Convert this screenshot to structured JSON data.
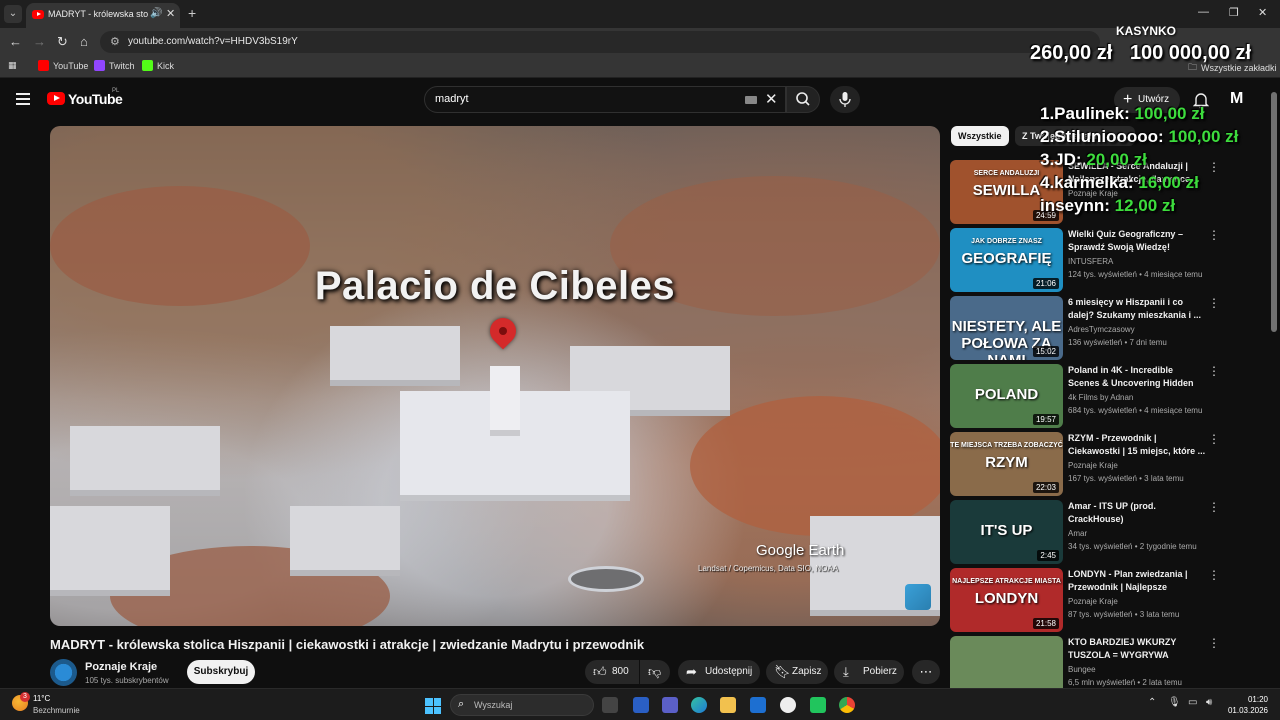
{
  "browser": {
    "tab_title": "MADRYT - królewska stolica Hiszpanii",
    "url": "youtube.com/watch?v=HHDV3bS19rY",
    "bookmarks": [
      {
        "label": "YouTube",
        "color": "#ff0000"
      },
      {
        "label": "Twitch",
        "color": "#9146ff"
      },
      {
        "label": "Kick",
        "color": "#53fc18"
      }
    ],
    "all_bookmarks_label": "Wszystkie zakładki"
  },
  "header": {
    "logo_text": "YouTube",
    "logo_region": "PL",
    "search_value": "madryt",
    "create_label": "Utwórz",
    "avatar_letter": "M"
  },
  "video": {
    "overlay_title": "Palacio de Cibeles",
    "google_earth": "Google Earth",
    "credit": "Landsat / Copernicus, Data SIO, NOAA",
    "title": "MADRYT - królewska stolica Hiszpanii | ciekawostki i atrakcje | zwiedzanie Madrytu i przewodnik",
    "channel": "Poznaje Kraje",
    "subscribers": "105 tys. subskrybentów",
    "subscribe_label": "Subskrybuj",
    "likes": "800",
    "share_label": "Udostępnij",
    "save_label": "Zapisz",
    "download_label": "Pobierz"
  },
  "chips": [
    "Wszystkie",
    "Z Twojego kanału"
  ],
  "recommendations": [
    {
      "title": "SEWILLA - Serce Andaluzji | Najlepsze atrakcje, flamenco...",
      "channel": "Poznaje Kraje",
      "meta": "",
      "duration": "24:59",
      "thumb_text": "SEWILLA",
      "thumb_sub": "SERCE ANDALUZJI",
      "bg": "#a0522d"
    },
    {
      "title": "Wielki Quiz Geograficzny – Sprawdź Swoją Wiedzę!",
      "channel": "INTUSFERA",
      "meta": "124 tys. wyświetleń • 4 miesiące temu",
      "duration": "21:06",
      "thumb_text": "GEOGRAFIĘ",
      "thumb_sub": "JAK DOBRZE ZNASZ",
      "bg": "#1f8fc2"
    },
    {
      "title": "6 miesięcy w Hiszpanii i co dalej? Szukamy mieszkania i ...",
      "channel": "AdresTymczasowy",
      "meta": "136 wyświetleń • 7 dni temu",
      "duration": "15:02",
      "thumb_text": "NIESTETY, ALE POŁOWA ZA NAMI",
      "thumb_sub": "",
      "bg": "#4a6a8a"
    },
    {
      "title": "Poland in 4K - Incredible Scenes & Uncovering Hidden Gems",
      "channel": "4k Films by Adnan",
      "meta": "684 tys. wyświetleń • 4 miesiące temu",
      "duration": "19:57",
      "thumb_text": "POLAND",
      "thumb_sub": "",
      "bg": "#4f7d4a"
    },
    {
      "title": "RZYM - Przewodnik | Ciekawostki | 15 miejsc, które ...",
      "channel": "Poznaje Kraje",
      "meta": "167 tys. wyświetleń • 3 lata temu",
      "duration": "22:03",
      "thumb_text": "RZYM",
      "thumb_sub": "TE MIEJSCA TRZEBA ZOBACZYĆ",
      "bg": "#8a6b4a"
    },
    {
      "title": "Amar - ITS UP (prod. CrackHouse)",
      "channel": "Amar",
      "meta": "34 tys. wyświetleń • 2 tygodnie temu",
      "duration": "2:45",
      "thumb_text": "IT'S UP",
      "thumb_sub": "",
      "bg": "#1a3a3a"
    },
    {
      "title": "LONDYN - Plan zwiedzania | Przewodnik | Najlepsze atrakcj...",
      "channel": "Poznaje Kraje",
      "meta": "87 tys. wyświetleń • 3 lata temu",
      "duration": "21:58",
      "thumb_text": "LONDYN",
      "thumb_sub": "NAJLEPSZE ATRAKCJE MIASTA",
      "bg": "#b02a2a"
    },
    {
      "title": "KTO BARDZIEJ WKURZY TUSZOLA = WYGRYWA",
      "channel": "Bungee",
      "meta": "6,5 mln wyświetleń • 2 lata temu",
      "duration": "",
      "thumb_text": "",
      "thumb_sub": "",
      "bg": "#6a8a5a"
    }
  ],
  "overlay": {
    "header": "KASYNKO",
    "amount_left": "260,00 zł",
    "amount_right": "100 000,00 zł",
    "ranking": [
      {
        "name": "1.Paulinek:",
        "amount": "100,00 zł"
      },
      {
        "name": "2.Stiluniooooo:",
        "amount": "100,00 zł"
      },
      {
        "name": "3.JD:",
        "amount": "20,00 zł"
      },
      {
        "name": "4.karmelka:",
        "amount": "16,00 zł"
      },
      {
        "name": "inseynn:",
        "amount": "12,00 zł"
      }
    ]
  },
  "taskbar": {
    "weather_badge": "3",
    "temperature": "11°C",
    "weather_desc": "Bezchmurnie",
    "search_placeholder": "Wyszukaj",
    "time": "01:20",
    "date": "01.03.2026"
  }
}
